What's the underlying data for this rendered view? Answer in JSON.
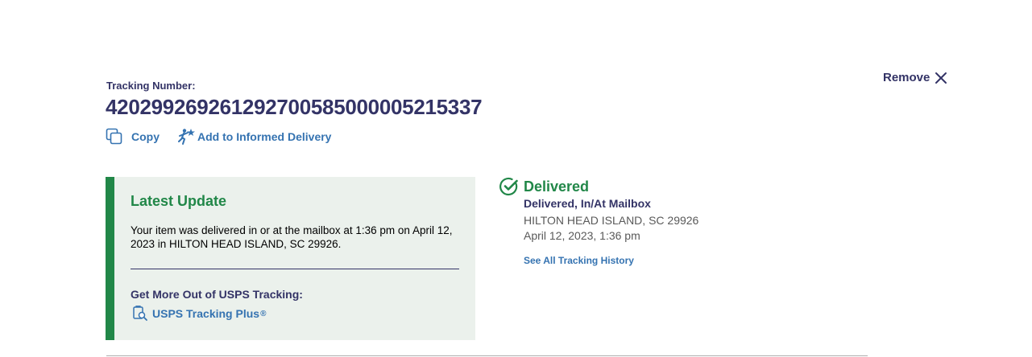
{
  "tracking": {
    "label": "Tracking Number:",
    "number": "420299269261292700585000005215337"
  },
  "actions": {
    "copy_label": "Copy",
    "copy_icon": "copy-icon",
    "informed_label": "Add to Informed Delivery",
    "informed_icon": "informed-delivery-icon"
  },
  "remove": {
    "label": "Remove",
    "icon": "close-icon"
  },
  "latest_update": {
    "title": "Latest Update",
    "body": "Your item was delivered in or at the mailbox at 1:36 pm on April 12, 2023 in HILTON HEAD ISLAND, SC 29926.",
    "more_title": "Get More Out of USPS Tracking:",
    "plus_label": "USPS Tracking Plus",
    "plus_mark": "®",
    "plus_icon": "tracking-plus-icon"
  },
  "status": {
    "title": "Delivered",
    "icon": "check-circle-icon",
    "detail": "Delivered, In/At Mailbox",
    "location": "HILTON HEAD ISLAND, SC 29926",
    "time": "April 12, 2023, 1:36 pm",
    "history_link": "See All Tracking History"
  },
  "colors": {
    "navy": "#333366",
    "link_blue": "#3573b1",
    "success_green": "#218748",
    "panel_bg": "#ebf1ec"
  }
}
